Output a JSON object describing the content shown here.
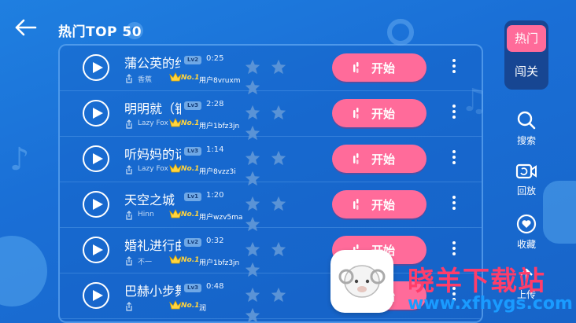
{
  "header": {
    "title": "热门TOP 50"
  },
  "songs": [
    {
      "title": "蒲公英的约定",
      "level": "Lv2",
      "duration": "0:25",
      "artist": "香蕉",
      "rank": "No.1",
      "user": "用户8vruxm"
    },
    {
      "title": "明明就（钢琴版）",
      "level": "Lv3",
      "duration": "2:28",
      "artist": "Lazy Fox",
      "rank": "No.1",
      "user": "用户1bfz3jn"
    },
    {
      "title": "听妈妈的话",
      "level": "Lv3",
      "duration": "1:14",
      "artist": "Lazy Fox",
      "rank": "No.1",
      "user": "用户8vzz3i"
    },
    {
      "title": "天空之城",
      "level": "Lv1",
      "duration": "1:20",
      "artist": "Hinn",
      "rank": "No.1",
      "user": "用户wzv5ma"
    },
    {
      "title": "婚礼进行曲",
      "level": "Lv2",
      "duration": "0:32",
      "artist": "不一",
      "rank": "No.1",
      "user": "用户1bfz3jn"
    },
    {
      "title": "巴赫小步舞曲",
      "level": "Lv3",
      "duration": "0:48",
      "artist": "",
      "rank": "No.1",
      "user": "润"
    }
  ],
  "labels": {
    "start": "开始"
  },
  "side": {
    "tabs": [
      "热门",
      "闯关"
    ],
    "actions": [
      {
        "label": "搜索",
        "icon": "search-icon"
      },
      {
        "label": "回放",
        "icon": "replay-icon"
      },
      {
        "label": "收藏",
        "icon": "favorite-icon"
      },
      {
        "label": "上传",
        "icon": "upload-icon"
      }
    ]
  },
  "watermark": {
    "text": "晓羊下载站",
    "url": "www.xfhygs.com"
  },
  "colors": {
    "accent": "#ff6b9a",
    "background": "#1a6fd6",
    "crown": "#ffd540"
  }
}
